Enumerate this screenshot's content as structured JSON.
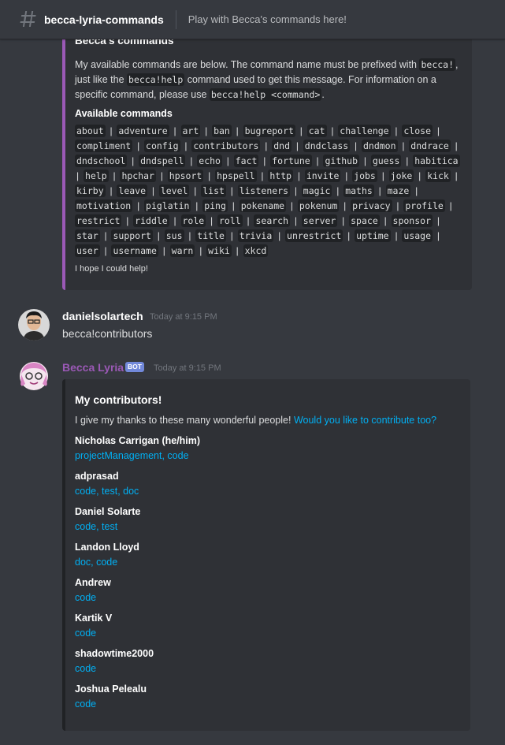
{
  "header": {
    "channel_name": "becca-lyria-commands",
    "topic": "Play with Becca's commands here!",
    "hash_icon": "hash-icon"
  },
  "embed1": {
    "title": "Becca's commands",
    "desc_part1": "My available commands are below. The command name must be prefixed with ",
    "prefix_code": "becca!",
    "desc_part2": ", just like the ",
    "help_code": "becca!help",
    "desc_part3": " command used to get this message. For information on a specific command, please use ",
    "help_cmd_code": "becca!help <command>",
    "desc_part4": ".",
    "field_name": "Available commands",
    "commands": [
      "about",
      "adventure",
      "art",
      "ban",
      "bugreport",
      "cat",
      "challenge",
      "close",
      "compliment",
      "config",
      "contributors",
      "dnd",
      "dndclass",
      "dndmon",
      "dndrace",
      "dndschool",
      "dndspell",
      "echo",
      "fact",
      "fortune",
      "github",
      "guess",
      "habitica",
      "help",
      "hpchar",
      "hpsort",
      "hpspell",
      "http",
      "invite",
      "jobs",
      "joke",
      "kick",
      "kirby",
      "leave",
      "level",
      "list",
      "listeners",
      "magic",
      "maths",
      "maze",
      "motivation",
      "piglatin",
      "ping",
      "pokename",
      "pokenum",
      "privacy",
      "profile",
      "restrict",
      "riddle",
      "role",
      "roll",
      "search",
      "server",
      "space",
      "sponsor",
      "star",
      "support",
      "sus",
      "title",
      "trivia",
      "unrestrict",
      "uptime",
      "usage",
      "user",
      "username",
      "warn",
      "wiki",
      "xkcd"
    ],
    "footer": "I hope I could help!",
    "accent_color": "#9b59b6"
  },
  "message1": {
    "author": "danielsolartech",
    "timestamp": "Today at 9:15 PM",
    "content": "becca!contributors"
  },
  "message2": {
    "author": "Becca Lyria",
    "bot_tag": "BOT",
    "timestamp": "Today at 9:15 PM",
    "author_color": "#9b59b6"
  },
  "embed2": {
    "title": "My contributors!",
    "desc": "I give my thanks to these many wonderful people! ",
    "desc_link": "Would you like to contribute too?",
    "contributors": [
      {
        "name": "Nicholas Carrigan (he/him)",
        "roles": "projectManagement, code"
      },
      {
        "name": "adprasad",
        "roles": "code, test, doc"
      },
      {
        "name": "Daniel Solarte",
        "roles": "code, test"
      },
      {
        "name": "Landon Lloyd",
        "roles": "doc, code"
      },
      {
        "name": "Andrew",
        "roles": "code"
      },
      {
        "name": "Kartik V",
        "roles": "code"
      },
      {
        "name": "shadowtime2000",
        "roles": "code"
      },
      {
        "name": "Joshua Pelealu",
        "roles": "code"
      }
    ]
  }
}
